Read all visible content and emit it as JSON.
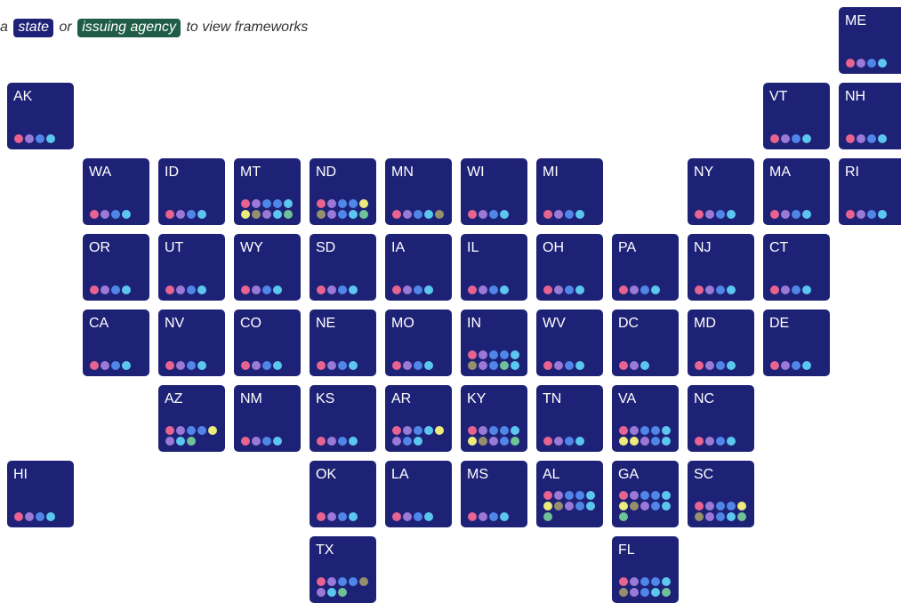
{
  "instruction": {
    "prefix": "a",
    "state_label": "state",
    "middle": "or",
    "agency_label": "issuing agency",
    "suffix": "to view frameworks"
  },
  "colors": {
    "tile": "#1e2277",
    "state_tag": "#1e2277",
    "agency_tag": "#1f5d46",
    "pink": "#e8638f",
    "purple": "#9a7ad6",
    "blue": "#4f86e8",
    "cyan": "#5bc7ef",
    "yellow": "#eceb7c",
    "green": "#6fc197",
    "olive": "#958f6d"
  },
  "states": [
    {
      "abbr": "ME",
      "dots": [
        "pink",
        "purple",
        "blue",
        "cyan"
      ]
    },
    {
      "abbr": "AK",
      "dots": [
        "pink",
        "purple",
        "blue",
        "cyan"
      ]
    },
    {
      "abbr": "VT",
      "dots": [
        "pink",
        "purple",
        "blue",
        "cyan"
      ]
    },
    {
      "abbr": "NH",
      "dots": [
        "pink",
        "purple",
        "blue",
        "cyan"
      ]
    },
    {
      "abbr": "WA",
      "dots": [
        "pink",
        "purple",
        "blue",
        "cyan"
      ]
    },
    {
      "abbr": "ID",
      "dots": [
        "pink",
        "purple",
        "blue",
        "cyan"
      ]
    },
    {
      "abbr": "MT",
      "dots": [
        "pink",
        "purple",
        "blue",
        "blue",
        "cyan",
        "yellow",
        "olive",
        "purple",
        "cyan",
        "green"
      ]
    },
    {
      "abbr": "ND",
      "dots": [
        "pink",
        "purple",
        "blue",
        "blue",
        "yellow",
        "olive",
        "purple",
        "blue",
        "cyan",
        "green"
      ]
    },
    {
      "abbr": "MN",
      "dots": [
        "pink",
        "purple",
        "blue",
        "cyan",
        "olive"
      ]
    },
    {
      "abbr": "WI",
      "dots": [
        "pink",
        "purple",
        "blue",
        "cyan"
      ]
    },
    {
      "abbr": "MI",
      "dots": [
        "pink",
        "purple",
        "blue",
        "cyan"
      ]
    },
    {
      "abbr": "NY",
      "dots": [
        "pink",
        "purple",
        "blue",
        "cyan"
      ]
    },
    {
      "abbr": "MA",
      "dots": [
        "pink",
        "purple",
        "blue",
        "cyan"
      ]
    },
    {
      "abbr": "RI",
      "dots": [
        "pink",
        "purple",
        "blue",
        "cyan"
      ]
    },
    {
      "abbr": "OR",
      "dots": [
        "pink",
        "purple",
        "blue",
        "cyan"
      ]
    },
    {
      "abbr": "UT",
      "dots": [
        "pink",
        "purple",
        "blue",
        "cyan"
      ]
    },
    {
      "abbr": "WY",
      "dots": [
        "pink",
        "purple",
        "blue",
        "cyan"
      ]
    },
    {
      "abbr": "SD",
      "dots": [
        "pink",
        "purple",
        "blue",
        "cyan"
      ]
    },
    {
      "abbr": "IA",
      "dots": [
        "pink",
        "purple",
        "blue",
        "cyan"
      ]
    },
    {
      "abbr": "IL",
      "dots": [
        "pink",
        "purple",
        "blue",
        "cyan"
      ]
    },
    {
      "abbr": "OH",
      "dots": [
        "pink",
        "purple",
        "blue",
        "cyan"
      ]
    },
    {
      "abbr": "PA",
      "dots": [
        "pink",
        "purple",
        "blue",
        "cyan"
      ]
    },
    {
      "abbr": "NJ",
      "dots": [
        "pink",
        "purple",
        "blue",
        "cyan"
      ]
    },
    {
      "abbr": "CT",
      "dots": [
        "pink",
        "purple",
        "blue",
        "cyan"
      ]
    },
    {
      "abbr": "CA",
      "dots": [
        "pink",
        "purple",
        "blue",
        "cyan"
      ]
    },
    {
      "abbr": "NV",
      "dots": [
        "pink",
        "purple",
        "blue",
        "cyan"
      ]
    },
    {
      "abbr": "CO",
      "dots": [
        "pink",
        "purple",
        "blue",
        "cyan"
      ]
    },
    {
      "abbr": "NE",
      "dots": [
        "pink",
        "purple",
        "blue",
        "cyan"
      ]
    },
    {
      "abbr": "MO",
      "dots": [
        "pink",
        "purple",
        "blue",
        "cyan"
      ]
    },
    {
      "abbr": "IN",
      "dots": [
        "pink",
        "purple",
        "blue",
        "blue",
        "cyan",
        "olive",
        "purple",
        "blue",
        "green",
        "cyan"
      ]
    },
    {
      "abbr": "WV",
      "dots": [
        "pink",
        "purple",
        "blue",
        "cyan"
      ]
    },
    {
      "abbr": "DC",
      "dots": [
        "pink",
        "purple",
        "cyan"
      ]
    },
    {
      "abbr": "MD",
      "dots": [
        "pink",
        "purple",
        "blue",
        "cyan"
      ]
    },
    {
      "abbr": "DE",
      "dots": [
        "pink",
        "purple",
        "blue",
        "cyan"
      ]
    },
    {
      "abbr": "AZ",
      "dots": [
        "pink",
        "purple",
        "blue",
        "blue",
        "yellow",
        "purple",
        "cyan",
        "green"
      ]
    },
    {
      "abbr": "NM",
      "dots": [
        "pink",
        "purple",
        "blue",
        "cyan"
      ]
    },
    {
      "abbr": "KS",
      "dots": [
        "pink",
        "purple",
        "blue",
        "cyan"
      ]
    },
    {
      "abbr": "AR",
      "dots": [
        "pink",
        "purple",
        "blue",
        "cyan",
        "yellow",
        "purple",
        "blue",
        "cyan"
      ]
    },
    {
      "abbr": "KY",
      "dots": [
        "pink",
        "purple",
        "blue",
        "blue",
        "cyan",
        "yellow",
        "olive",
        "purple",
        "blue",
        "green"
      ]
    },
    {
      "abbr": "TN",
      "dots": [
        "pink",
        "purple",
        "blue",
        "cyan"
      ]
    },
    {
      "abbr": "VA",
      "dots": [
        "pink",
        "purple",
        "blue",
        "blue",
        "cyan",
        "yellow",
        "yellow",
        "purple",
        "blue",
        "cyan"
      ]
    },
    {
      "abbr": "NC",
      "dots": [
        "pink",
        "purple",
        "blue",
        "cyan"
      ]
    },
    {
      "abbr": "HI",
      "dots": [
        "pink",
        "purple",
        "blue",
        "cyan"
      ]
    },
    {
      "abbr": "OK",
      "dots": [
        "pink",
        "purple",
        "blue",
        "cyan"
      ]
    },
    {
      "abbr": "LA",
      "dots": [
        "pink",
        "purple",
        "blue",
        "cyan"
      ]
    },
    {
      "abbr": "MS",
      "dots": [
        "pink",
        "purple",
        "blue",
        "cyan"
      ]
    },
    {
      "abbr": "AL",
      "dots": [
        "pink",
        "purple",
        "blue",
        "blue",
        "cyan",
        "yellow",
        "olive",
        "purple",
        "blue",
        "cyan",
        "green"
      ]
    },
    {
      "abbr": "GA",
      "dots": [
        "pink",
        "purple",
        "blue",
        "blue",
        "cyan",
        "yellow",
        "olive",
        "purple",
        "blue",
        "cyan",
        "green"
      ]
    },
    {
      "abbr": "SC",
      "dots": [
        "pink",
        "purple",
        "blue",
        "blue",
        "yellow",
        "olive",
        "purple",
        "blue",
        "cyan",
        "green"
      ]
    },
    {
      "abbr": "TX",
      "dots": [
        "pink",
        "purple",
        "blue",
        "blue",
        "olive",
        "purple",
        "cyan",
        "green"
      ]
    },
    {
      "abbr": "FL",
      "dots": [
        "pink",
        "purple",
        "blue",
        "blue",
        "cyan",
        "olive",
        "purple",
        "blue",
        "cyan",
        "green"
      ]
    }
  ]
}
